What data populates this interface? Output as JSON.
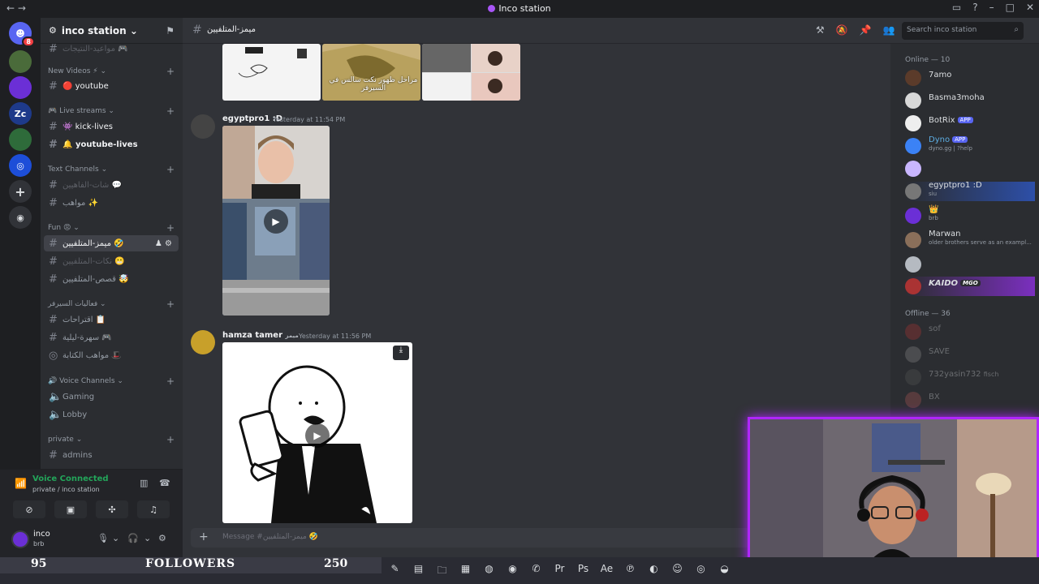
{
  "window": {
    "title": "Inco station",
    "nav": "←  →"
  },
  "server": {
    "name": "inco station"
  },
  "channel_sections": [
    {
      "name": "New Videos",
      "emoji": "⚡",
      "channels": [
        {
          "name": "youtube",
          "emoji": "🔴"
        }
      ]
    },
    {
      "name": "Live streams",
      "channels": [
        {
          "name": "kick-lives",
          "emoji": "👾"
        },
        {
          "name": "youtube-lives",
          "emoji": "🔔"
        }
      ]
    },
    {
      "name": "Text Channels",
      "channels": [
        {
          "name": "شات-الفاهيين",
          "emoji": "💬"
        },
        {
          "name": "مواهب",
          "emoji": "✨"
        }
      ]
    },
    {
      "name": "Fun",
      "emoji": "😡",
      "channels": [
        {
          "name": "ميمز-المتلفيين",
          "emoji": "🤣"
        },
        {
          "name": "نكات-المتلفيين",
          "emoji": "😬"
        },
        {
          "name": "قصص-المتلفيين",
          "emoji": "🤯"
        }
      ]
    },
    {
      "name": "فعاليات السيرفر",
      "channels": [
        {
          "name": "اقتراحات",
          "emoji": "📋"
        },
        {
          "name": "سهرة-ليلية",
          "emoji": "🎮"
        },
        {
          "name": "مواهب الكتابة",
          "emoji": "🎩"
        }
      ]
    },
    {
      "name": "Voice Channels",
      "channels": [
        {
          "name": "Gaming"
        },
        {
          "name": "Lobby"
        }
      ]
    },
    {
      "name": "private",
      "channels": [
        {
          "name": "admins"
        }
      ]
    }
  ],
  "active_channel": "ميمز-المتلفيين",
  "voice": {
    "status": "Voice Connected",
    "location": "private / inco station"
  },
  "user": {
    "name": "inco",
    "status": "brb"
  },
  "search": {
    "placeholder": "Search inco station"
  },
  "messages": [
    {
      "author": "egyptpro1 :D",
      "time": "Yesterday at 11:54 PM"
    },
    {
      "author": "hamza tamer",
      "tag": "ميمز",
      "time": "Yesterday at 11:56 PM"
    }
  ],
  "meme_caption_top": "مراحل ظهور نكت سالس في السيرفر",
  "composer": {
    "placeholder": "Message #ميمز-المتلفيين 🤣"
  },
  "members": {
    "online_label": "Online — 10",
    "online": [
      {
        "name": "7amo",
        "color": "#5b3b2a"
      },
      {
        "name": "Basma3moha",
        "color": "#d8d8d8"
      },
      {
        "name": "BotRix",
        "tag": "APP",
        "color": "#eeeeee"
      },
      {
        "name": "Dyno",
        "tag": "APP",
        "sub": "dyno.gg | ?help",
        "color": "#3b82f6"
      },
      {
        "name": "",
        "color": "#c9b6ff"
      },
      {
        "name": "egyptpro1 :D",
        "sub": "siu",
        "color": "#777777"
      },
      {
        "name": "",
        "sub": "brb",
        "color": "#6b2fd6"
      },
      {
        "name": "Marwan",
        "sub": "older brothers serve as an exampl...",
        "color": "#8a6f5a"
      },
      {
        "name": "",
        "color": "#b5bac1"
      },
      {
        "name": "KAIDO",
        "tag": "MGO",
        "color": "#a33"
      }
    ],
    "offline_label": "Offline — 36",
    "offline": [
      {
        "name": "sof"
      },
      {
        "name": "SAVE"
      },
      {
        "name": "732yasin732",
        "sub": "fisch"
      },
      {
        "name": "BX"
      }
    ]
  },
  "overlay": {
    "count_left": "95",
    "label": "FOLLOWERS",
    "count_right": "250"
  }
}
